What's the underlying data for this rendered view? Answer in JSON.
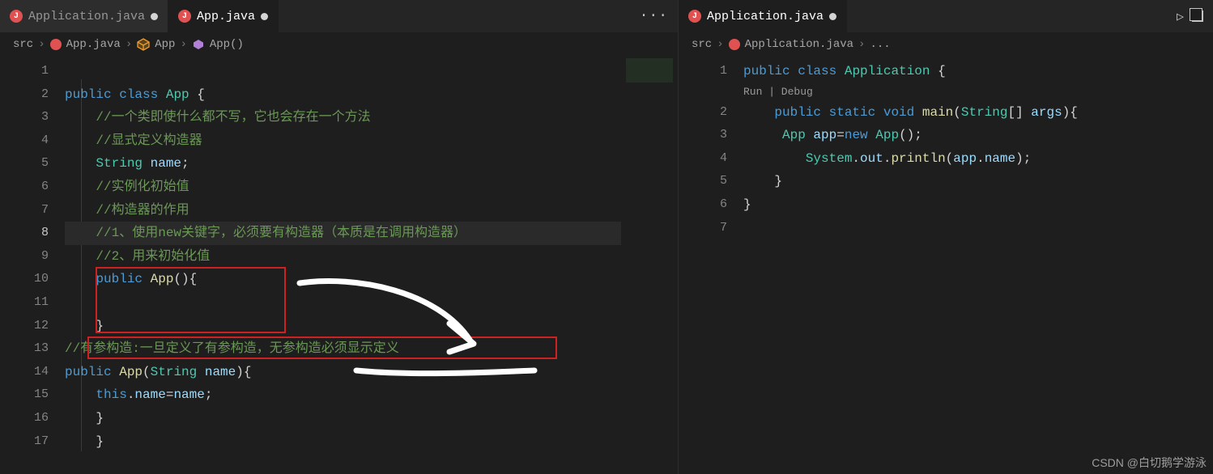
{
  "tabs_left": [
    {
      "name": "Application.java",
      "dirty": true,
      "active": false
    },
    {
      "name": "App.java",
      "dirty": true,
      "active": true
    }
  ],
  "tabs_right": [
    {
      "name": "Application.java",
      "dirty": true,
      "active": true
    }
  ],
  "breadcrumb_left": {
    "root": "src",
    "file": "App.java",
    "class": "App",
    "method": "App()"
  },
  "breadcrumb_right": {
    "root": "src",
    "file": "Application.java",
    "more": "..."
  },
  "code_left": {
    "l1": "",
    "l2_kw1": "public",
    "l2_kw2": "class",
    "l2_type": "App",
    "l2_brace": " {",
    "l3": "//一个类即使什么都不写，它也会存在一个方法",
    "l4": "//显式定义构造器",
    "l5_type": "String",
    "l5_name": "name",
    "l5_semi": ";",
    "l6": "//实例化初始值",
    "l7": "//构造器的作用",
    "l8": "//1、使用new关键字，必须要有构造器（本质是在调用构造器）",
    "l9": "//2、用来初始化值",
    "l10_kw": "public",
    "l10_fn": "App",
    "l10_rest": "(){",
    "l11": "",
    "l12": "}",
    "l13": "//有参构造:一旦定义了有参构造，无参构造必须显示定义",
    "l14_kw": "public",
    "l14_fn": "App",
    "l14_p1": "(",
    "l14_type": "String",
    "l14_arg": " name",
    "l14_p2": "){",
    "l15_this": "this",
    "l15_dot": ".",
    "l15_n1": "name",
    "l15_eq": "=",
    "l15_n2": "name",
    "l15_semi": ";",
    "l16": "}",
    "l17": "}"
  },
  "gutter_left": [
    "1",
    "2",
    "3",
    "4",
    "5",
    "6",
    "7",
    "8",
    "9",
    "10",
    "11",
    "12",
    "13",
    "14",
    "15",
    "16",
    "17"
  ],
  "code_right": {
    "l1_kw1": "public",
    "l1_kw2": "class",
    "l1_type": "Application",
    "l1_brace": " {",
    "codelens": "Run | Debug",
    "l2_kw1": "public",
    "l2_kw2": "static",
    "l2_kw3": "void",
    "l2_fn": "main",
    "l2_p": "(",
    "l2_type": "String",
    "l2_arr": "[] ",
    "l2_arg": "args",
    "l2_rest": "){",
    "l3_type": "App",
    "l3_var": " app",
    "l3_eq": "=",
    "l3_new": "new",
    "l3_ctor": " App",
    "l3_call": "();",
    "l4_sys": "System",
    "l4_d1": ".",
    "l4_out": "out",
    "l4_d2": ".",
    "l4_pr": "println",
    "l4_p": "(",
    "l4_app": "app",
    "l4_d3": ".",
    "l4_name": "name",
    "l4_end": ");",
    "l5": "}",
    "l6": "}",
    "l7": ""
  },
  "gutter_right": [
    "1",
    "2",
    "3",
    "4",
    "5",
    "6",
    "7"
  ],
  "watermark": "CSDN @白切鹅学游泳",
  "icons": {
    "more": "···",
    "run": "▷",
    "stack": ""
  }
}
